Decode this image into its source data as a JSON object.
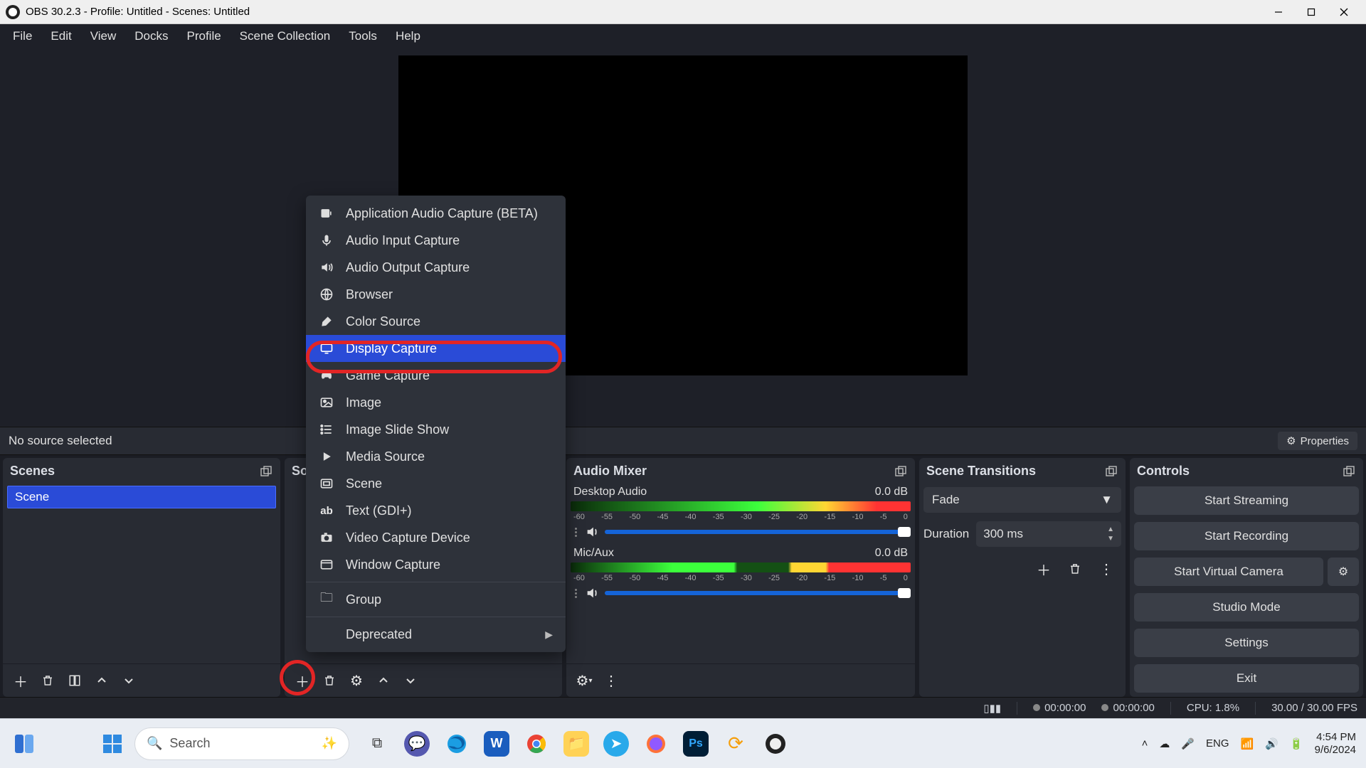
{
  "titlebar": {
    "title": "OBS 30.2.3 - Profile: Untitled - Scenes: Untitled"
  },
  "menubar": [
    "File",
    "Edit",
    "View",
    "Docks",
    "Profile",
    "Scene Collection",
    "Tools",
    "Help"
  ],
  "status_strip": {
    "no_source": "No source selected",
    "properties": "Properties"
  },
  "panels": {
    "scenes": {
      "title": "Scenes",
      "items": [
        "Scene"
      ]
    },
    "sources": {
      "title": "Sources"
    },
    "mixer": {
      "title": "Audio Mixer",
      "channels": [
        {
          "name": "Desktop Audio",
          "level": "0.0 dB"
        },
        {
          "name": "Mic/Aux",
          "level": "0.0 dB"
        }
      ],
      "ticks": [
        "-60",
        "-55",
        "-50",
        "-45",
        "-40",
        "-35",
        "-30",
        "-25",
        "-20",
        "-15",
        "-10",
        "-5",
        "0"
      ]
    },
    "transitions": {
      "title": "Scene Transitions",
      "selected": "Fade",
      "duration_label": "Duration",
      "duration_value": "300 ms"
    },
    "controls": {
      "title": "Controls",
      "start_streaming": "Start Streaming",
      "start_recording": "Start Recording",
      "start_virtual_cam": "Start Virtual Camera",
      "studio_mode": "Studio Mode",
      "settings": "Settings",
      "exit": "Exit"
    }
  },
  "statusbar": {
    "rec_time": "00:00:00",
    "live_time": "00:00:00",
    "cpu": "CPU: 1.8%",
    "fps": "30.00 / 30.00 FPS"
  },
  "context_menu": {
    "items": [
      {
        "label": "Application Audio Capture (BETA)",
        "icon": "app-audio"
      },
      {
        "label": "Audio Input Capture",
        "icon": "mic"
      },
      {
        "label": "Audio Output Capture",
        "icon": "speaker"
      },
      {
        "label": "Browser",
        "icon": "globe"
      },
      {
        "label": "Color Source",
        "icon": "brush"
      },
      {
        "label": "Display Capture",
        "icon": "display",
        "highlight": true
      },
      {
        "label": "Game Capture",
        "icon": "gamepad"
      },
      {
        "label": "Image",
        "icon": "image"
      },
      {
        "label": "Image Slide Show",
        "icon": "list"
      },
      {
        "label": "Media Source",
        "icon": "play"
      },
      {
        "label": "Scene",
        "icon": "scene"
      },
      {
        "label": "Text (GDI+)",
        "icon": "text"
      },
      {
        "label": "Video Capture Device",
        "icon": "camera"
      },
      {
        "label": "Window Capture",
        "icon": "window"
      }
    ],
    "group": "Group",
    "deprecated": "Deprecated"
  },
  "taskbar": {
    "search_placeholder": "Search",
    "lang": "ENG",
    "time": "4:54 PM",
    "date": "9/6/2024"
  }
}
